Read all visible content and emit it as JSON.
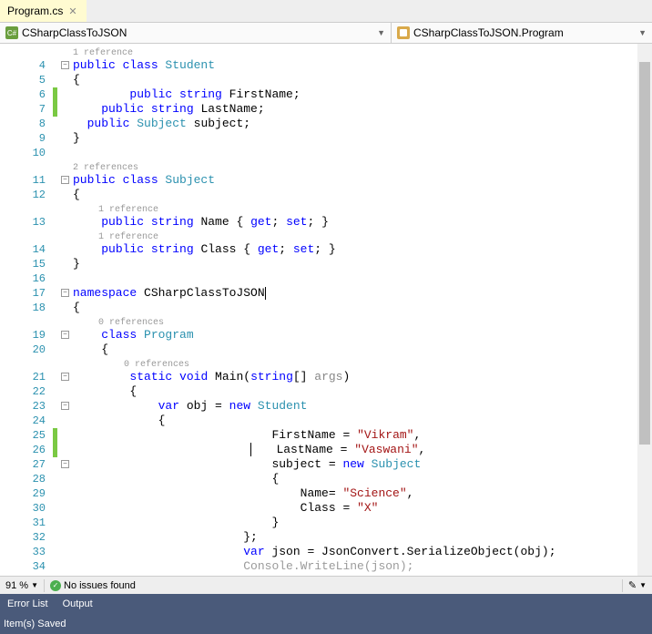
{
  "tab": {
    "name": "Program.cs",
    "close": "✕"
  },
  "nav": {
    "left": {
      "icon": "csharp-file-icon",
      "text": "CSharpClassToJSON"
    },
    "right": {
      "icon": "class-icon",
      "text": "CSharpClassToJSON.Program"
    }
  },
  "refs": {
    "one": "1 reference",
    "two": "2 references",
    "zero": "0 references"
  },
  "code": {
    "l4a": "public",
    "l4b": " class ",
    "l4c": "Student",
    "l5": "{",
    "l6a": "public",
    "l6b": " string",
    "l6c": " FirstName;",
    "l7a": "public",
    "l7b": " string",
    "l7c": " LastName;",
    "l8a": "public",
    "l8b": " Subject",
    "l8c": " subject;",
    "l9": "}",
    "l11a": "public",
    "l11b": " class ",
    "l11c": "Subject",
    "l12": "{",
    "l13a": "public",
    "l13b": " string",
    "l13c": " Name { ",
    "l13d": "get",
    "l13e": "; ",
    "l13f": "set",
    "l13g": "; }",
    "l14a": "public",
    "l14b": " string",
    "l14c": " Class { ",
    "l14d": "get",
    "l14e": "; ",
    "l14f": "set",
    "l14g": "; }",
    "l15": "}",
    "l17a": "namespace",
    "l17b": " CSharpClassToJSON",
    "l18": "{",
    "l19a": "class ",
    "l19b": "Program",
    "l20": "{",
    "l21a": "static",
    "l21b": " void",
    "l21c": " Main(",
    "l21d": "string",
    "l21e": "[] ",
    "l21f": "args",
    "l21g": ")",
    "l22": "{",
    "l23a": "var",
    "l23b": " obj = ",
    "l23c": "new",
    "l23d": " Student",
    "l24": "{",
    "l25a": "FirstName = ",
    "l25b": "\"Vikram\"",
    "l25c": ",",
    "l26a": "LastName = ",
    "l26b": "\"Vaswani\"",
    "l26c": ",",
    "l27a": "subject = ",
    "l27b": "new",
    "l27c": " Subject",
    "l28": "{",
    "l29a": "Name= ",
    "l29b": "\"Science\"",
    "l29c": ",",
    "l30a": "Class = ",
    "l30b": "\"X\"",
    "l31": "}",
    "l32": "};",
    "l33a": "var",
    "l33b": " json = JsonConvert.SerializeObject(obj);",
    "l34": "Console.WriteLine(json);"
  },
  "lines": [
    "4",
    "5",
    "6",
    "7",
    "8",
    "9",
    "10",
    "11",
    "12",
    "13",
    "14",
    "15",
    "16",
    "17",
    "18",
    "19",
    "20",
    "21",
    "22",
    "23",
    "24",
    "25",
    "26",
    "27",
    "28",
    "29",
    "30",
    "31",
    "32",
    "33",
    "34"
  ],
  "status": {
    "zoom": "91 %",
    "issues": "No issues found"
  },
  "bottom_tabs": {
    "error": "Error List",
    "output": "Output"
  },
  "footer": "Item(s) Saved"
}
